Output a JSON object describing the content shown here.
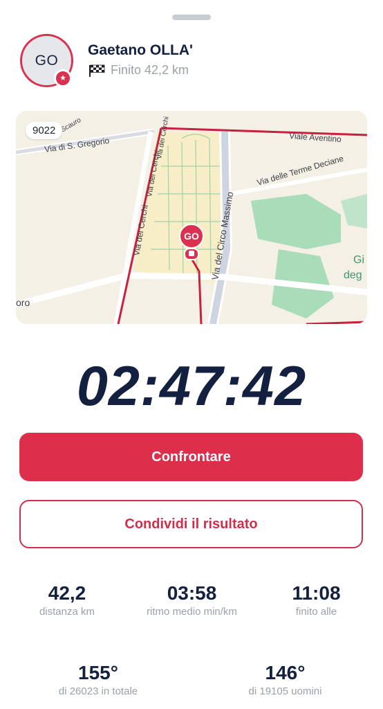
{
  "sheet": {
    "grabber": "drag-handle"
  },
  "runner": {
    "initials": "GO",
    "name": "Gaetano OLLA'",
    "status": "Finito 42,2 km",
    "status_icon": "checkered-flag-icon"
  },
  "map": {
    "bib": "9022",
    "marker": "GO",
    "streets": {
      "s_gregorio": "Via di S. Gregorio",
      "cerchi_1": "Via dei Cerchi",
      "cerchi_2": "Via dei Cerchi",
      "cerchi_3": "Via dei Cerchi",
      "circo_massimo": "Via del Circo Massimo",
      "aventino": "Viale Aventino",
      "terme_deciane": "Via delle Terme Deciane",
      "scauro": "o Scauro",
      "oro": "oro",
      "gi": "Gi",
      "deg": "deg"
    },
    "route_color": "#c8213f",
    "park_color": "#a9dcb8"
  },
  "finish_time": "02:47:42",
  "actions": {
    "compare_label": "Confrontare",
    "share_label": "Condividi il risultato"
  },
  "stats": {
    "distance": {
      "value": "42,2",
      "label": "distanza km"
    },
    "pace": {
      "value": "03:58",
      "label": "ritmo medio min/km"
    },
    "finished_at": {
      "value": "11:08",
      "label": "finito alle"
    },
    "overall_rank": {
      "value": "155°",
      "label": "di 26023 in totale"
    },
    "gender_rank": {
      "value": "146°",
      "label": "di 19105 uomini"
    }
  },
  "colors": {
    "accent": "#dd2f4b",
    "navy": "#13203f",
    "muted": "#9ba0a9"
  }
}
